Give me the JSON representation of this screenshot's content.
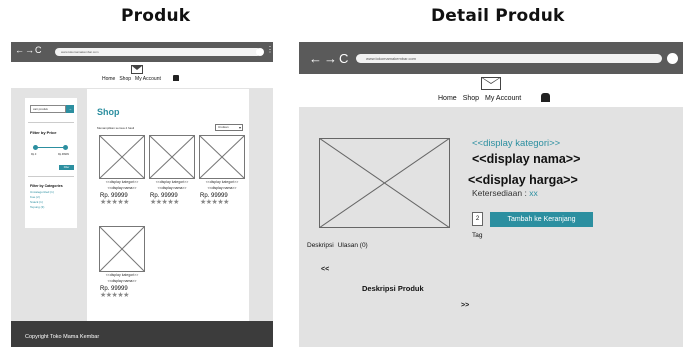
{
  "headings": {
    "left": "Produk",
    "right": "Detail Produk"
  },
  "browser": {
    "nav_arrows": "←→C",
    "left_url": "www.tokomamakembar.com",
    "right_url": "www.tokomamakembar.com",
    "menu_glyph": "⋮"
  },
  "nav": {
    "home": "Home",
    "shop": "Shop",
    "account": "My Account"
  },
  "shop": {
    "search_value": "cari produk",
    "search_button": "→",
    "filter_price_title": "Filter by Price",
    "price_min": "Rp.0",
    "price_max": "Rp.99999",
    "filter_button": "Filter",
    "category_title": "Filter by Categories",
    "categories": [
      "Uncategorized (1)",
      "Kue (2)",
      "Snack (1)",
      "Tepung (3)"
    ],
    "title": "Shop",
    "showing": "Menampilkan semua 4 hasil",
    "sort": "Urutkan",
    "products": [
      {
        "category": "<<display kategori>>",
        "name": "<<display nama>>",
        "price": "Rp. 99999",
        "stars": "★★★★★"
      },
      {
        "category": "<<display kategori>>",
        "name": "<<display nama>>",
        "price": "Rp. 99999",
        "stars": "★★★★★"
      },
      {
        "category": "<<display kategori>>",
        "name": "<<display nama>>",
        "price": "Rp. 99999",
        "stars": "★★★★★"
      },
      {
        "category": "<<display kategori>>",
        "name": "<<display nama>>",
        "price": "Rp. 99999",
        "stars": "★★★★★"
      }
    ],
    "footer": "Copyright Toko Mama Kembar"
  },
  "detail": {
    "category": "<<display kategori>>",
    "name": "<<display nama>>",
    "price": "<<display harga>>",
    "stock_label": "Ketersediaan : ",
    "stock_value": "xx",
    "quantity": "2",
    "add_to_cart": "Tambah ke Keranjang",
    "tag": "Tag",
    "tab_description": "Deskripsi",
    "tab_reviews": "Ulasan (0)",
    "prev": "<<",
    "description_title": "Deskripsi Produk",
    "next": ">>"
  },
  "icons": {
    "logo": "envelope-icon",
    "cart": "shopping-bag-icon"
  },
  "colors": {
    "accent": "#2c8fa0",
    "browser_bar": "#5a5a5a",
    "footer": "#3c3c3c",
    "page_bg": "#e3e3e3"
  }
}
